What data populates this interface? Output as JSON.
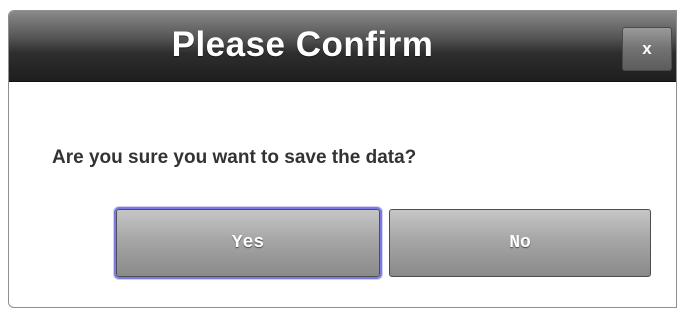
{
  "dialog": {
    "title": "Please Confirm",
    "close_label": "x",
    "message": "Are you sure you want to save the data?",
    "yes_label": "Yes",
    "no_label": "No"
  },
  "colors": {
    "titlebar": "#2e2e2e",
    "button": "#a6a6a6",
    "focus_ring": "#7a7ae0",
    "message_text": "#333333"
  },
  "state": {
    "focused_button": "Yes"
  }
}
